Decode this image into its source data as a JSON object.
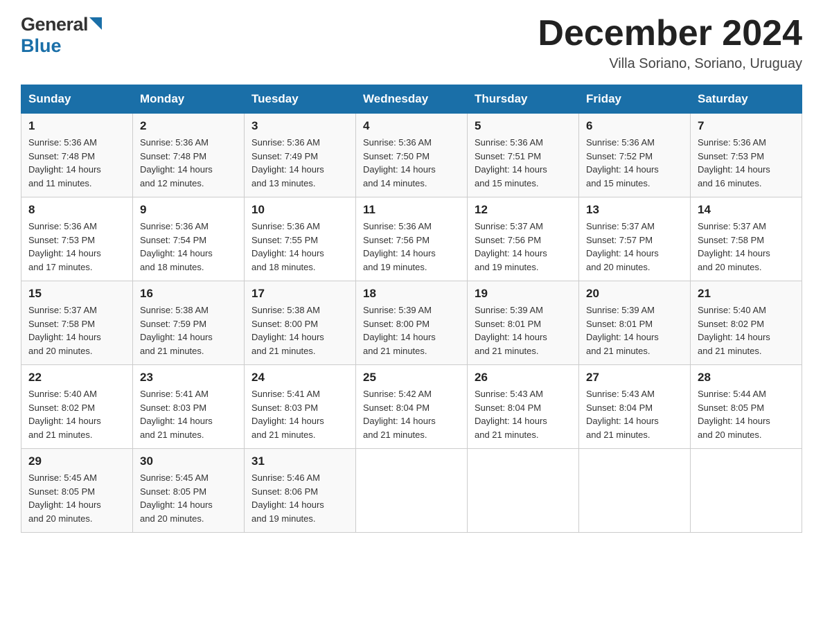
{
  "header": {
    "logo_general": "General",
    "logo_blue": "Blue",
    "month_title": "December 2024",
    "subtitle": "Villa Soriano, Soriano, Uruguay"
  },
  "days_of_week": [
    "Sunday",
    "Monday",
    "Tuesday",
    "Wednesday",
    "Thursday",
    "Friday",
    "Saturday"
  ],
  "weeks": [
    [
      {
        "day": "1",
        "sunrise": "5:36 AM",
        "sunset": "7:48 PM",
        "daylight": "14 hours and 11 minutes."
      },
      {
        "day": "2",
        "sunrise": "5:36 AM",
        "sunset": "7:48 PM",
        "daylight": "14 hours and 12 minutes."
      },
      {
        "day": "3",
        "sunrise": "5:36 AM",
        "sunset": "7:49 PM",
        "daylight": "14 hours and 13 minutes."
      },
      {
        "day": "4",
        "sunrise": "5:36 AM",
        "sunset": "7:50 PM",
        "daylight": "14 hours and 14 minutes."
      },
      {
        "day": "5",
        "sunrise": "5:36 AM",
        "sunset": "7:51 PM",
        "daylight": "14 hours and 15 minutes."
      },
      {
        "day": "6",
        "sunrise": "5:36 AM",
        "sunset": "7:52 PM",
        "daylight": "14 hours and 15 minutes."
      },
      {
        "day": "7",
        "sunrise": "5:36 AM",
        "sunset": "7:53 PM",
        "daylight": "14 hours and 16 minutes."
      }
    ],
    [
      {
        "day": "8",
        "sunrise": "5:36 AM",
        "sunset": "7:53 PM",
        "daylight": "14 hours and 17 minutes."
      },
      {
        "day": "9",
        "sunrise": "5:36 AM",
        "sunset": "7:54 PM",
        "daylight": "14 hours and 18 minutes."
      },
      {
        "day": "10",
        "sunrise": "5:36 AM",
        "sunset": "7:55 PM",
        "daylight": "14 hours and 18 minutes."
      },
      {
        "day": "11",
        "sunrise": "5:36 AM",
        "sunset": "7:56 PM",
        "daylight": "14 hours and 19 minutes."
      },
      {
        "day": "12",
        "sunrise": "5:37 AM",
        "sunset": "7:56 PM",
        "daylight": "14 hours and 19 minutes."
      },
      {
        "day": "13",
        "sunrise": "5:37 AM",
        "sunset": "7:57 PM",
        "daylight": "14 hours and 20 minutes."
      },
      {
        "day": "14",
        "sunrise": "5:37 AM",
        "sunset": "7:58 PM",
        "daylight": "14 hours and 20 minutes."
      }
    ],
    [
      {
        "day": "15",
        "sunrise": "5:37 AM",
        "sunset": "7:58 PM",
        "daylight": "14 hours and 20 minutes."
      },
      {
        "day": "16",
        "sunrise": "5:38 AM",
        "sunset": "7:59 PM",
        "daylight": "14 hours and 21 minutes."
      },
      {
        "day": "17",
        "sunrise": "5:38 AM",
        "sunset": "8:00 PM",
        "daylight": "14 hours and 21 minutes."
      },
      {
        "day": "18",
        "sunrise": "5:39 AM",
        "sunset": "8:00 PM",
        "daylight": "14 hours and 21 minutes."
      },
      {
        "day": "19",
        "sunrise": "5:39 AM",
        "sunset": "8:01 PM",
        "daylight": "14 hours and 21 minutes."
      },
      {
        "day": "20",
        "sunrise": "5:39 AM",
        "sunset": "8:01 PM",
        "daylight": "14 hours and 21 minutes."
      },
      {
        "day": "21",
        "sunrise": "5:40 AM",
        "sunset": "8:02 PM",
        "daylight": "14 hours and 21 minutes."
      }
    ],
    [
      {
        "day": "22",
        "sunrise": "5:40 AM",
        "sunset": "8:02 PM",
        "daylight": "14 hours and 21 minutes."
      },
      {
        "day": "23",
        "sunrise": "5:41 AM",
        "sunset": "8:03 PM",
        "daylight": "14 hours and 21 minutes."
      },
      {
        "day": "24",
        "sunrise": "5:41 AM",
        "sunset": "8:03 PM",
        "daylight": "14 hours and 21 minutes."
      },
      {
        "day": "25",
        "sunrise": "5:42 AM",
        "sunset": "8:04 PM",
        "daylight": "14 hours and 21 minutes."
      },
      {
        "day": "26",
        "sunrise": "5:43 AM",
        "sunset": "8:04 PM",
        "daylight": "14 hours and 21 minutes."
      },
      {
        "day": "27",
        "sunrise": "5:43 AM",
        "sunset": "8:04 PM",
        "daylight": "14 hours and 21 minutes."
      },
      {
        "day": "28",
        "sunrise": "5:44 AM",
        "sunset": "8:05 PM",
        "daylight": "14 hours and 20 minutes."
      }
    ],
    [
      {
        "day": "29",
        "sunrise": "5:45 AM",
        "sunset": "8:05 PM",
        "daylight": "14 hours and 20 minutes."
      },
      {
        "day": "30",
        "sunrise": "5:45 AM",
        "sunset": "8:05 PM",
        "daylight": "14 hours and 20 minutes."
      },
      {
        "day": "31",
        "sunrise": "5:46 AM",
        "sunset": "8:06 PM",
        "daylight": "14 hours and 19 minutes."
      },
      null,
      null,
      null,
      null
    ]
  ],
  "labels": {
    "sunrise": "Sunrise:",
    "sunset": "Sunset:",
    "daylight": "Daylight:"
  }
}
